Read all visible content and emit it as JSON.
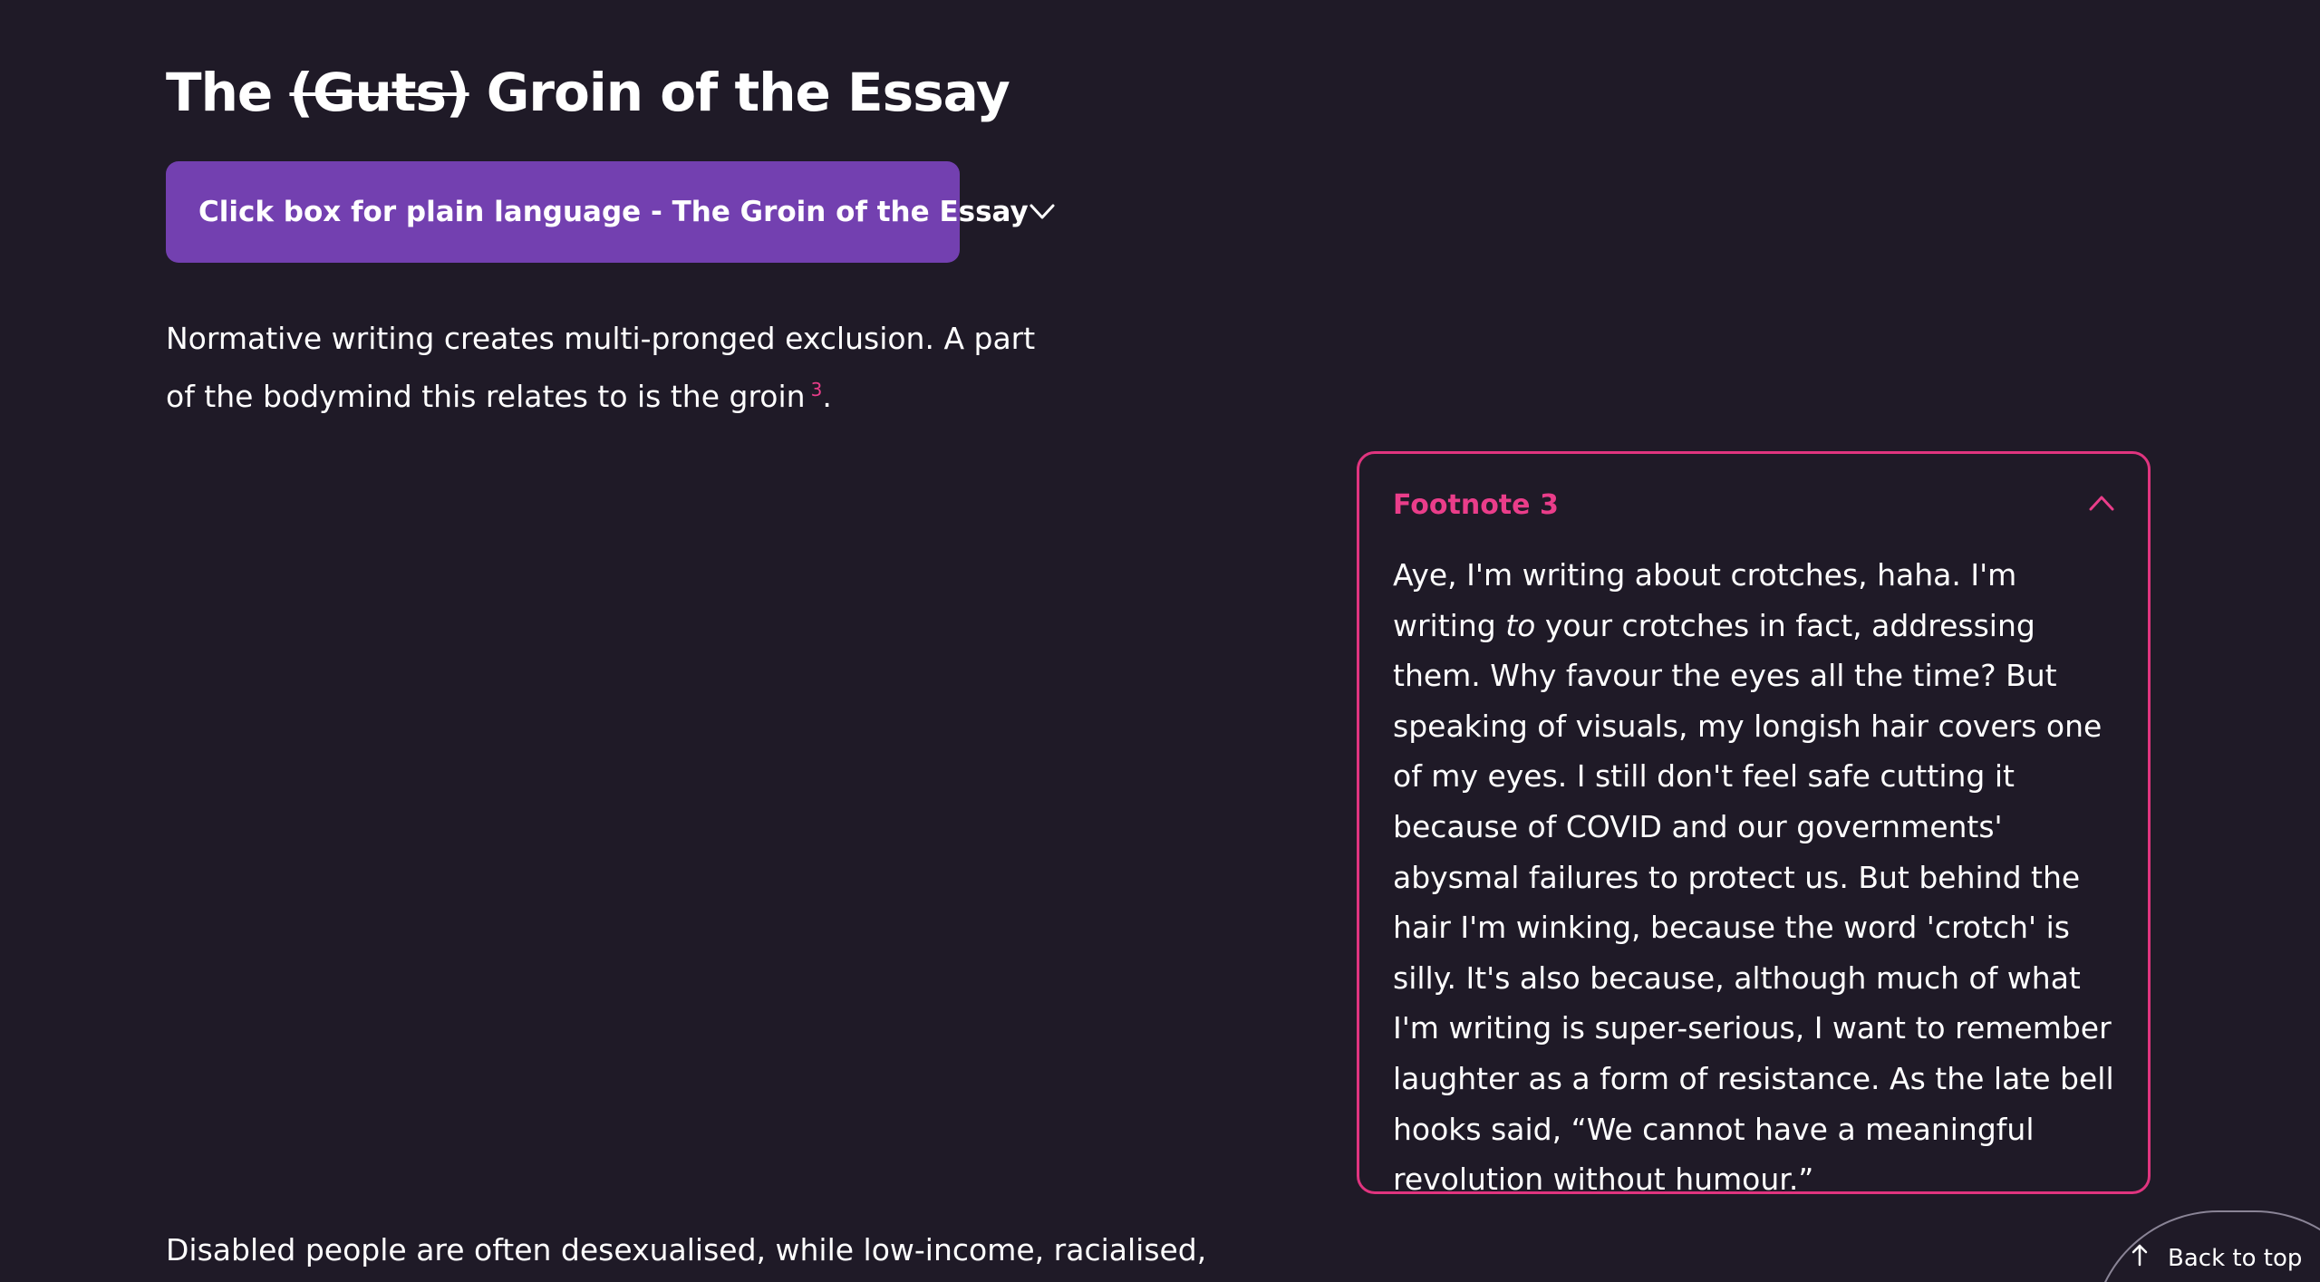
{
  "heading": {
    "prefix": "The",
    "struck": "(Guts)",
    "suffix": "Groin of the Essay"
  },
  "plain_language": {
    "label": "Click box for plain language - The Groin of the Essay",
    "icon": "chevron-down-icon",
    "color": "#7340b0"
  },
  "paragraph1": {
    "text": "Normative writing creates multi-pronged exclusion. A part of the bodymind this relates to is the groin",
    "footnote_ref": "3",
    "end": "."
  },
  "footnote": {
    "title": "Footnote 3",
    "icon": "chevron-up-icon",
    "accent": "#e0347f",
    "text_before_italic": "Aye, I'm writing about crotches, haha. I'm writing ",
    "italic": "to",
    "text_after_italic": " your crotches in fact, addressing them. Why favour the eyes all the time? But speaking of visuals, my longish hair covers one of my eyes. I still don't feel safe cutting it because of COVID and our governments' abysmal failures to protect us. But behind the hair I'm winking, because the word 'crotch' is silly. It's also because, although much of what I'm writing is super-serious, I want to remember laughter as a form of resistance. As the late bell hooks said, “We cannot have a meaningful revolution without humour.”"
  },
  "paragraph2": {
    "text": "Disabled people are often desexualised, while low-income, racialised,"
  },
  "back_to_top": {
    "label": "Back to top",
    "icon": "arrow-up-icon"
  },
  "colors": {
    "background": "#1f1a27",
    "text": "#ffffff",
    "pink": "#ea3d8a"
  }
}
